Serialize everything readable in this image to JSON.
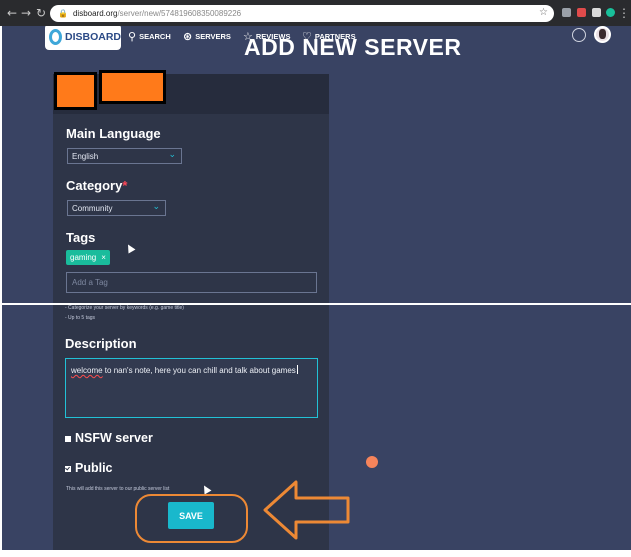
{
  "browser": {
    "url_host": "disboard.org",
    "url_path": "/server/new/574819608350089226"
  },
  "header": {
    "logo_text": "DISBOARD",
    "nav": [
      {
        "label": "SEARCH",
        "icon": "search-icon"
      },
      {
        "label": "SERVERS",
        "icon": "gamepad-icon"
      },
      {
        "label": "REVIEWS",
        "icon": "star-icon"
      },
      {
        "label": "PARTNERS",
        "icon": "heart-icon"
      }
    ]
  },
  "page_title": "ADD NEW SERVER",
  "form": {
    "main_language": {
      "label": "Main Language",
      "value": "English"
    },
    "category": {
      "label": "Category",
      "required_mark": "*",
      "value": "Community"
    },
    "tags": {
      "label": "Tags",
      "chips": [
        {
          "text": "gaming",
          "remove": "×"
        }
      ],
      "placeholder": "Add a Tag",
      "hints": [
        "- Categorize your server by keywords (e.g. game title)",
        "- Up to 5 tags"
      ]
    },
    "description": {
      "label": "Description",
      "first_word": "welcome",
      "rest": " to nan's note, here you can chill and talk about games"
    },
    "nsfw": {
      "label": "NSFW server",
      "checked": false
    },
    "public": {
      "label": "Public",
      "checked": true,
      "note": "This will add this server to our public server list"
    },
    "save_label": "SAVE"
  },
  "colors": {
    "accent": "#19b8cc",
    "background": "#394363",
    "panel": "#2e3548",
    "annotation_orange": "#ed8935",
    "redaction_orange": "#ff7a1a"
  }
}
